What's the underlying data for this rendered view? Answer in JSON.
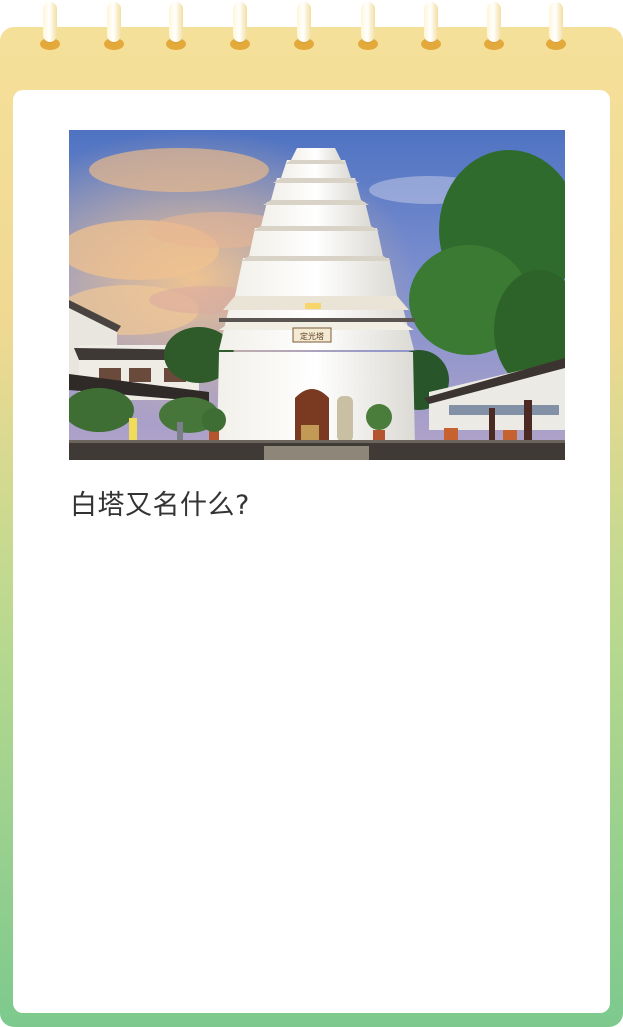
{
  "question": {
    "text": "白塔又名什么?"
  },
  "photo": {
    "subject": "white-pagoda",
    "plaque_text": "定光塔"
  },
  "colors": {
    "frame_top": "#f5e09a",
    "frame_bottom": "#7dc98d",
    "ring_hole": "#e3a93a",
    "text": "#333333"
  }
}
